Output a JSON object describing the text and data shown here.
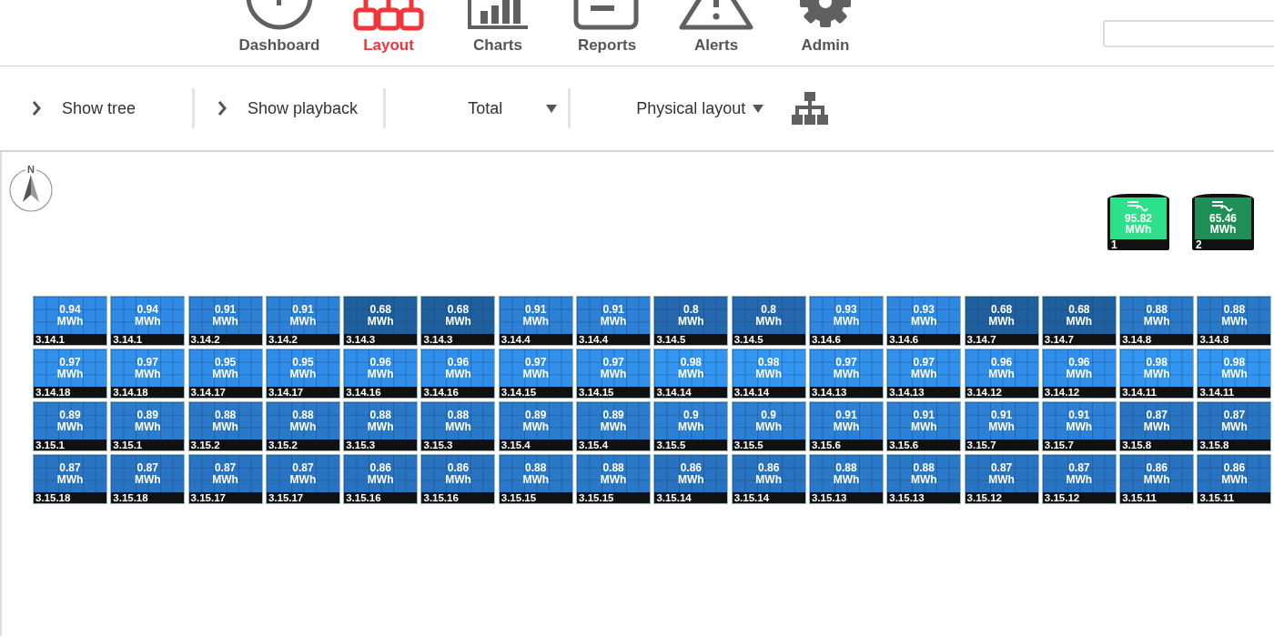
{
  "nav": [
    {
      "kind": "gauge",
      "label": "Dashboard",
      "selected": false
    },
    {
      "kind": "layout",
      "label": "Layout",
      "selected": true
    },
    {
      "kind": "charts",
      "label": "Charts",
      "selected": false
    },
    {
      "kind": "reports",
      "label": "Reports",
      "selected": false
    },
    {
      "kind": "alerts",
      "label": "Alerts",
      "selected": false
    },
    {
      "kind": "admin",
      "label": "Admin",
      "selected": false
    }
  ],
  "toolbar": {
    "toggles": [
      {
        "label": "Show tree",
        "expanded": false
      },
      {
        "label": "Show playback",
        "expanded": false
      }
    ],
    "dropdowns": [
      {
        "value": "Total"
      },
      {
        "value": "Physical layout"
      }
    ]
  },
  "compass": {
    "label": "N"
  },
  "inverters": [
    {
      "value": "95.82",
      "unit": "MWh",
      "label": "1",
      "color": "#2ee08a"
    },
    {
      "value": "65.46",
      "unit": "MWh",
      "label": "2",
      "color": "#1f8f57"
    }
  ],
  "panel_rows": [
    [
      {
        "value": "0.94",
        "unit": "MWh",
        "label": "3.14.1",
        "color": "#2f8ae6"
      },
      {
        "value": "0.94",
        "unit": "MWh",
        "label": "3.14.1",
        "color": "#2f8ae6"
      },
      {
        "value": "0.91",
        "unit": "MWh",
        "label": "3.14.2",
        "color": "#2c80d6"
      },
      {
        "value": "0.91",
        "unit": "MWh",
        "label": "3.14.2",
        "color": "#2c80d6"
      },
      {
        "value": "0.68",
        "unit": "MWh",
        "label": "3.14.3",
        "color": "#1f5f9e"
      },
      {
        "value": "0.68",
        "unit": "MWh",
        "label": "3.14.3",
        "color": "#1f5f9e"
      },
      {
        "value": "0.91",
        "unit": "MWh",
        "label": "3.14.4",
        "color": "#2c80d6"
      },
      {
        "value": "0.91",
        "unit": "MWh",
        "label": "3.14.4",
        "color": "#2c80d6"
      },
      {
        "value": "0.8",
        "unit": "MWh",
        "label": "3.14.5",
        "color": "#2668b0"
      },
      {
        "value": "0.8",
        "unit": "MWh",
        "label": "3.14.5",
        "color": "#2668b0"
      },
      {
        "value": "0.93",
        "unit": "MWh",
        "label": "3.14.6",
        "color": "#2e88e2"
      },
      {
        "value": "0.93",
        "unit": "MWh",
        "label": "3.14.6",
        "color": "#2e88e2"
      },
      {
        "value": "0.68",
        "unit": "MWh",
        "label": "3.14.7",
        "color": "#1f5f9e"
      },
      {
        "value": "0.68",
        "unit": "MWh",
        "label": "3.14.7",
        "color": "#1f5f9e"
      },
      {
        "value": "0.88",
        "unit": "MWh",
        "label": "3.14.8",
        "color": "#2a78c8"
      },
      {
        "value": "0.88",
        "unit": "MWh",
        "label": "3.14.8",
        "color": "#2a78c8"
      }
    ],
    [
      {
        "value": "0.97",
        "unit": "MWh",
        "label": "3.14.18",
        "color": "#3090ea"
      },
      {
        "value": "0.97",
        "unit": "MWh",
        "label": "3.14.18",
        "color": "#3090ea"
      },
      {
        "value": "0.95",
        "unit": "MWh",
        "label": "3.14.17",
        "color": "#2f8ce8"
      },
      {
        "value": "0.95",
        "unit": "MWh",
        "label": "3.14.17",
        "color": "#2f8ce8"
      },
      {
        "value": "0.96",
        "unit": "MWh",
        "label": "3.14.16",
        "color": "#2f8ee9"
      },
      {
        "value": "0.96",
        "unit": "MWh",
        "label": "3.14.16",
        "color": "#2f8ee9"
      },
      {
        "value": "0.97",
        "unit": "MWh",
        "label": "3.14.15",
        "color": "#3090ea"
      },
      {
        "value": "0.97",
        "unit": "MWh",
        "label": "3.14.15",
        "color": "#3090ea"
      },
      {
        "value": "0.98",
        "unit": "MWh",
        "label": "3.14.14",
        "color": "#3296f0"
      },
      {
        "value": "0.98",
        "unit": "MWh",
        "label": "3.14.14",
        "color": "#3296f0"
      },
      {
        "value": "0.97",
        "unit": "MWh",
        "label": "3.14.13",
        "color": "#3090ea"
      },
      {
        "value": "0.97",
        "unit": "MWh",
        "label": "3.14.13",
        "color": "#3090ea"
      },
      {
        "value": "0.96",
        "unit": "MWh",
        "label": "3.14.12",
        "color": "#2f8ee9"
      },
      {
        "value": "0.96",
        "unit": "MWh",
        "label": "3.14.12",
        "color": "#2f8ee9"
      },
      {
        "value": "0.98",
        "unit": "MWh",
        "label": "3.14.11",
        "color": "#3296f0"
      },
      {
        "value": "0.98",
        "unit": "MWh",
        "label": "3.14.11",
        "color": "#3296f0"
      }
    ],
    [
      {
        "value": "0.89",
        "unit": "MWh",
        "label": "3.15.1",
        "color": "#2b7ccf"
      },
      {
        "value": "0.89",
        "unit": "MWh",
        "label": "3.15.1",
        "color": "#2b7ccf"
      },
      {
        "value": "0.88",
        "unit": "MWh",
        "label": "3.15.2",
        "color": "#2a78c8"
      },
      {
        "value": "0.88",
        "unit": "MWh",
        "label": "3.15.2",
        "color": "#2a78c8"
      },
      {
        "value": "0.88",
        "unit": "MWh",
        "label": "3.15.3",
        "color": "#2a78c8"
      },
      {
        "value": "0.88",
        "unit": "MWh",
        "label": "3.15.3",
        "color": "#2a78c8"
      },
      {
        "value": "0.89",
        "unit": "MWh",
        "label": "3.15.4",
        "color": "#2b7ccf"
      },
      {
        "value": "0.89",
        "unit": "MWh",
        "label": "3.15.4",
        "color": "#2b7ccf"
      },
      {
        "value": "0.9",
        "unit": "MWh",
        "label": "3.15.5",
        "color": "#2c7fd3"
      },
      {
        "value": "0.9",
        "unit": "MWh",
        "label": "3.15.5",
        "color": "#2c7fd3"
      },
      {
        "value": "0.91",
        "unit": "MWh",
        "label": "3.15.6",
        "color": "#2c80d6"
      },
      {
        "value": "0.91",
        "unit": "MWh",
        "label": "3.15.6",
        "color": "#2c80d6"
      },
      {
        "value": "0.91",
        "unit": "MWh",
        "label": "3.15.7",
        "color": "#2c80d6"
      },
      {
        "value": "0.91",
        "unit": "MWh",
        "label": "3.15.7",
        "color": "#2c80d6"
      },
      {
        "value": "0.87",
        "unit": "MWh",
        "label": "3.15.8",
        "color": "#2974c2"
      },
      {
        "value": "0.87",
        "unit": "MWh",
        "label": "3.15.8",
        "color": "#2974c2"
      }
    ],
    [
      {
        "value": "0.87",
        "unit": "MWh",
        "label": "3.15.18",
        "color": "#2974c2"
      },
      {
        "value": "0.87",
        "unit": "MWh",
        "label": "3.15.18",
        "color": "#2974c2"
      },
      {
        "value": "0.87",
        "unit": "MWh",
        "label": "3.15.17",
        "color": "#2974c2"
      },
      {
        "value": "0.87",
        "unit": "MWh",
        "label": "3.15.17",
        "color": "#2974c2"
      },
      {
        "value": "0.86",
        "unit": "MWh",
        "label": "3.15.16",
        "color": "#2872c0"
      },
      {
        "value": "0.86",
        "unit": "MWh",
        "label": "3.15.16",
        "color": "#2872c0"
      },
      {
        "value": "0.88",
        "unit": "MWh",
        "label": "3.15.15",
        "color": "#2a78c8"
      },
      {
        "value": "0.88",
        "unit": "MWh",
        "label": "3.15.15",
        "color": "#2a78c8"
      },
      {
        "value": "0.86",
        "unit": "MWh",
        "label": "3.15.14",
        "color": "#2872c0"
      },
      {
        "value": "0.86",
        "unit": "MWh",
        "label": "3.15.14",
        "color": "#2872c0"
      },
      {
        "value": "0.88",
        "unit": "MWh",
        "label": "3.15.13",
        "color": "#2a78c8"
      },
      {
        "value": "0.88",
        "unit": "MWh",
        "label": "3.15.13",
        "color": "#2a78c8"
      },
      {
        "value": "0.87",
        "unit": "MWh",
        "label": "3.15.12",
        "color": "#2974c2"
      },
      {
        "value": "0.87",
        "unit": "MWh",
        "label": "3.15.12",
        "color": "#2974c2"
      },
      {
        "value": "0.86",
        "unit": "MWh",
        "label": "3.15.11",
        "color": "#2872c0"
      },
      {
        "value": "0.86",
        "unit": "MWh",
        "label": "3.15.11",
        "color": "#2872c0"
      }
    ]
  ]
}
